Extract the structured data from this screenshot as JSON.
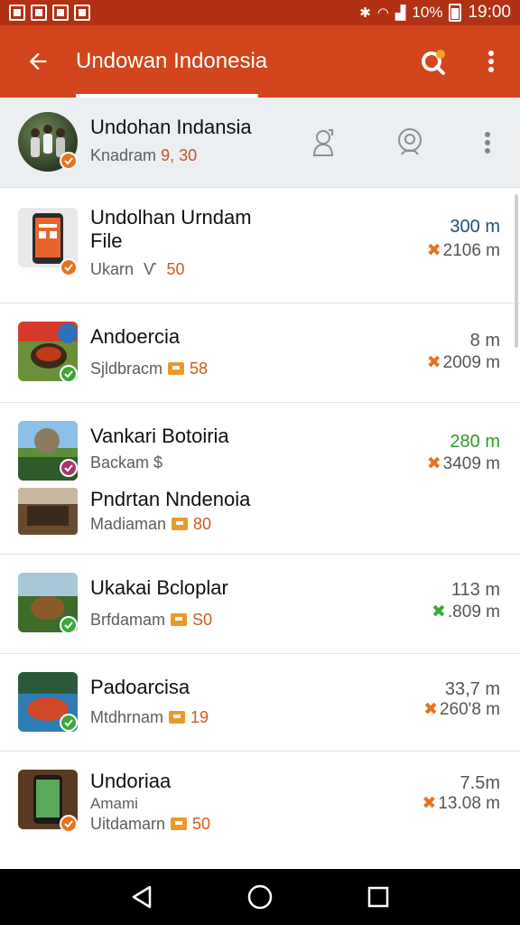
{
  "status_bar": {
    "battery": "10%",
    "time": "19:00"
  },
  "app_bar": {
    "title": "Undowan Indonesia"
  },
  "profile": {
    "name": "Undohan Indansia",
    "sub_text": "Knadram",
    "sub_num": "9, 30"
  },
  "items": [
    {
      "title_line1": "Undolhan Urndam",
      "title_line2": "File",
      "sub_text": "Ukarn",
      "sub_sep": "Ѵ",
      "sub_num": "50",
      "value_primary": "300 m",
      "value_secondary": "2106 m",
      "mark": "✖",
      "badge": "orange"
    },
    {
      "title_line1": "Andoercia",
      "sub_text": "Sjldbracm",
      "sub_num": "58",
      "value_primary": "8 m",
      "value_secondary": "2009 m",
      "mark": "✖",
      "badge": "green"
    },
    {
      "title_line1": "Vankari Botoiria",
      "sub_text": "Backam $",
      "sub_num": "",
      "value_primary": "280 m",
      "value_secondary": "3409 m",
      "mark": "✖",
      "badge": "purple"
    },
    {
      "title_line1": "Pndrtan Nndenoia",
      "sub_text": "Madiaman",
      "sub_num": "80"
    },
    {
      "title_line1": "Ukakai Bcloplar",
      "sub_text": "Brfdamam",
      "sub_num": "S0",
      "value_primary": "113 m",
      "value_secondary": ".809 m",
      "mark": "✖",
      "badge": "green"
    },
    {
      "title_line1": "Padoarcisa",
      "sub_text": "Mtdhrnam",
      "sub_num": "19",
      "value_primary": "33,7 m",
      "value_secondary": "260'8 m",
      "mark": "✖",
      "badge": "green"
    },
    {
      "title_line1": "Undoriaa",
      "title_line2": "Amami",
      "sub_text": "Uitdamarn",
      "sub_num": "50",
      "value_primary": "7.5m",
      "value_secondary": "13.08 m",
      "mark": "✖",
      "badge": "orange"
    }
  ],
  "colors": {
    "status_bar": "#b23114",
    "app_bar": "#d3451d",
    "accent_orange": "#e8731e",
    "badge_green": "#3aa83a",
    "badge_purple": "#a8356f",
    "value_blue": "#1e4f7a",
    "value_green": "#2d9a2d"
  }
}
